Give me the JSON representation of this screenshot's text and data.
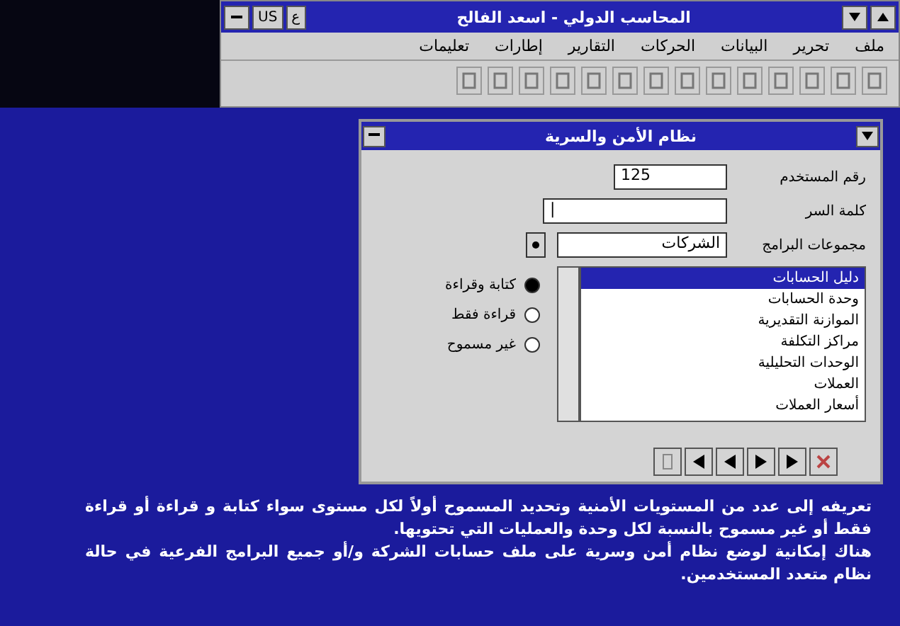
{
  "window": {
    "title": "المحاسب الدولي - اسعد الفالح",
    "language": "US",
    "script_key": "ع",
    "menu": [
      "ملف",
      "تحرير",
      "البيانات",
      "الحركات",
      "التقارير",
      "إطارات",
      "تعليمات"
    ]
  },
  "dialog": {
    "title": "نظام الأمن والسرية",
    "fields": [
      {
        "kind": "text",
        "label": "رقم المستخدم",
        "value": "125"
      },
      {
        "kind": "text",
        "label": "كلمة السر",
        "value": "|"
      },
      {
        "kind": "combo",
        "label": "مجموعات البرامج",
        "value": "الشركات"
      }
    ],
    "list": [
      {
        "label": "دليل الحسابات",
        "selected": true
      },
      {
        "label": "وحدة الحسابات",
        "selected": false
      },
      {
        "label": "الموازنة التقديرية",
        "selected": false
      },
      {
        "label": "مراكز التكلفة",
        "selected": false
      },
      {
        "label": "الوحدات التحليلية",
        "selected": false
      },
      {
        "label": "العملات",
        "selected": false
      },
      {
        "label": "أسعار العملات",
        "selected": false
      }
    ],
    "radios": [
      {
        "label": "كتابة وقراءة",
        "selected": true
      },
      {
        "label": "قراءة فقط",
        "selected": false
      },
      {
        "label": "غير مسموح",
        "selected": false
      }
    ]
  },
  "description": [
    "تعريفه إلى عدد من المستويات الأمنية وتحديد المسموح أولاً لكل مستوى سواء كتابة و قراءة أو قراءة فقط أو غير مسموح بالنسبة لكل وحدة والعمليات التي تحتويها.",
    "هناك إمكانية لوضع نظام أمن وسرية على ملف حسابات الشركة و/أو جميع البرامج الفرعية في حالة نظام متعدد المستخدمين."
  ]
}
